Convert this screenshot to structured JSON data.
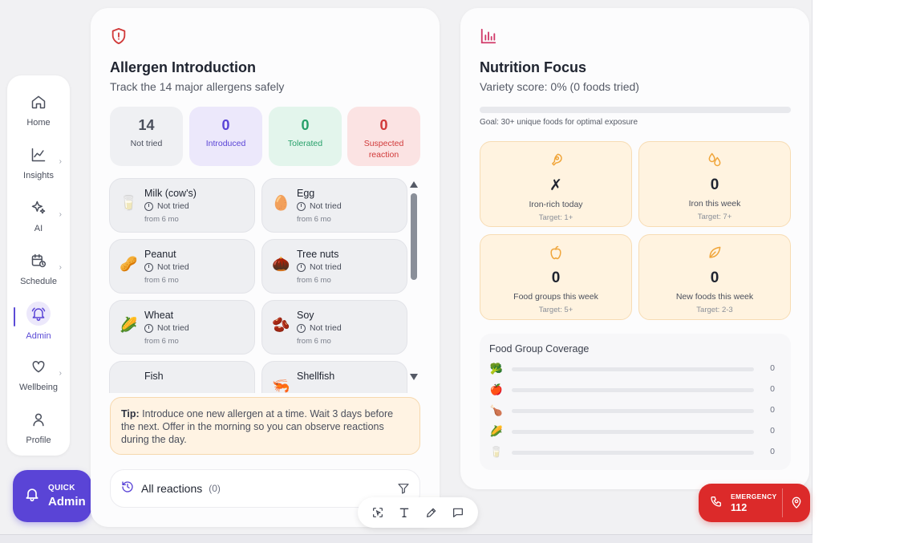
{
  "sidebar": {
    "items": [
      {
        "label": "Home",
        "icon": "home-icon"
      },
      {
        "label": "Insights",
        "icon": "chart-line-icon"
      },
      {
        "label": "AI",
        "icon": "sparkles-icon"
      },
      {
        "label": "Schedule",
        "icon": "calendar-clock-icon"
      },
      {
        "label": "Admin",
        "icon": "bell-icon",
        "active": true
      },
      {
        "label": "Wellbeing",
        "icon": "heart-icon"
      },
      {
        "label": "Profile",
        "icon": "user-icon"
      }
    ],
    "chevron": "›"
  },
  "quick": {
    "label_small": "QUICK",
    "label": "Admin"
  },
  "allergen": {
    "title": "Allergen Introduction",
    "subtitle": "Track the 14 major allergens safely",
    "stats": [
      {
        "value": "14",
        "label": "Not tried",
        "bg": "#eff0f3",
        "color": "#4a4f5c"
      },
      {
        "value": "0",
        "label": "Introduced",
        "bg": "#ece8fb",
        "color": "#5a44d6"
      },
      {
        "value": "0",
        "label": "Tolerated",
        "bg": "#e3f5ec",
        "color": "#27a06a"
      },
      {
        "value": "0",
        "label": "Suspected reaction",
        "bg": "#fbe3e3",
        "color": "#d13a3a"
      }
    ],
    "items": [
      {
        "name": "Milk (cow's)",
        "status": "Not tried",
        "age": "from 6 mo",
        "emoji": "🥛"
      },
      {
        "name": "Egg",
        "status": "Not tried",
        "age": "from 6 mo",
        "emoji": "🥚"
      },
      {
        "name": "Peanut",
        "status": "Not tried",
        "age": "from 6 mo",
        "emoji": "🥜"
      },
      {
        "name": "Tree nuts",
        "status": "Not tried",
        "age": "from 6 mo",
        "emoji": "🌰"
      },
      {
        "name": "Wheat",
        "status": "Not tried",
        "age": "from 6 mo",
        "emoji": "🌽"
      },
      {
        "name": "Soy",
        "status": "Not tried",
        "age": "from 6 mo",
        "emoji": "🫘"
      },
      {
        "name": "Fish",
        "status": "",
        "age": "",
        "emoji": ""
      },
      {
        "name": "Shellfish",
        "status": "",
        "age": "",
        "emoji": "🦐"
      }
    ],
    "tip_label": "Tip:",
    "tip_text": " Introduce one new allergen at a time. Wait 3 days before the next. Offer in the morning so you can observe reactions during the day.",
    "reactions_label": "All reactions",
    "reactions_count": "(0)"
  },
  "nutrition": {
    "title": "Nutrition Focus",
    "subtitle": "Variety score: 0% (0 foods tried)",
    "variety_fraction": 0,
    "goal": "Goal: 30+ unique foods for optimal exposure",
    "metrics": [
      {
        "value": "✗",
        "label": "Iron-rich today",
        "target": "Target: 1+",
        "icon": "meat-icon"
      },
      {
        "value": "0",
        "label": "Iron this week",
        "target": "Target: 7+",
        "icon": "droplets-icon"
      },
      {
        "value": "0",
        "label": "Food groups this week",
        "target": "Target: 5+",
        "icon": "apple-icon"
      },
      {
        "value": "0",
        "label": "New foods this week",
        "target": "Target: 2-3",
        "icon": "leaf-icon"
      }
    ],
    "coverage_title": "Food Group Coverage",
    "coverage": [
      {
        "emoji": "🥦",
        "value": "0",
        "fraction": 0
      },
      {
        "emoji": "🍎",
        "value": "0",
        "fraction": 0
      },
      {
        "emoji": "🍗",
        "value": "0",
        "fraction": 0
      },
      {
        "emoji": "🌽",
        "value": "0",
        "fraction": 0
      },
      {
        "emoji": "🥛",
        "value": "0",
        "fraction": 0
      }
    ]
  },
  "emergency": {
    "label_small": "EMERGENCY",
    "number": "112"
  },
  "colors": {
    "accent": "#5a44d6",
    "danger": "#dc2a2a",
    "warm": "#f0a53a"
  }
}
